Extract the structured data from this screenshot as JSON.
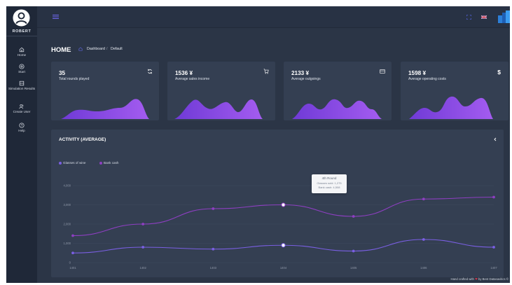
{
  "sidebar": {
    "user_name": "ROBERT",
    "items": [
      {
        "label": "Home",
        "icon": "home-icon"
      },
      {
        "label": "Start",
        "icon": "play-circle-icon"
      },
      {
        "label": "Simulation Results",
        "icon": "results-icon"
      },
      {
        "label": "Create User",
        "icon": "users-icon"
      },
      {
        "label": "Help",
        "icon": "help-circle-icon"
      }
    ]
  },
  "topbar": {
    "menu_icon": "menu-icon",
    "fullscreen_icon": "fullscreen-icon",
    "language_icon": "uk-flag-icon",
    "logo_icon": "logo-icon"
  },
  "page": {
    "title": "HOME",
    "breadcrumb": [
      "Dashboard",
      "Default"
    ]
  },
  "cards": [
    {
      "value": "35",
      "label": "Total rounds played",
      "icon": "refresh-icon"
    },
    {
      "value": "1536 ¥",
      "label": "Average sales income",
      "icon": "cart-icon"
    },
    {
      "value": "2133 ¥",
      "label": "Average outgoings",
      "icon": "wallet-icon"
    },
    {
      "value": "1598 ¥",
      "label": "Average operating costs",
      "icon_text": "$"
    }
  ],
  "activity": {
    "title": "ACTIVITY (AVERAGE)",
    "collapse_icon": "chevron-left-icon",
    "tooltip": {
      "title": "4th Round",
      "line1": "Glasses sold: 1,275",
      "line2": "Bank cash: 4,508"
    }
  },
  "colors": {
    "accent": "#7b53e8",
    "series_glasses": "#7a5fe3",
    "series_bank": "#8e3fc2",
    "background": "#2b3546",
    "card": "#343f52"
  },
  "chart_data": {
    "type": "line",
    "categories": [
      "1401",
      "1402",
      "1403",
      "1404",
      "1405",
      "1406",
      "1407"
    ],
    "series": [
      {
        "name": "Glasses of wine",
        "values": [
          500,
          800,
          700,
          900,
          600,
          1200,
          800
        ]
      },
      {
        "name": "Bank cash",
        "values": [
          1400,
          2000,
          2800,
          3000,
          2400,
          3300,
          3400
        ]
      }
    ],
    "y_ticks": [
      "0",
      "1,000",
      "2,000",
      "3,000",
      "4,000"
    ],
    "ylim": [
      0,
      4000
    ],
    "grid": true,
    "legend_position": "top-left"
  },
  "footer": {
    "prefix": "Hand crafted with",
    "suffix": "by Best Datasavitics ©"
  }
}
